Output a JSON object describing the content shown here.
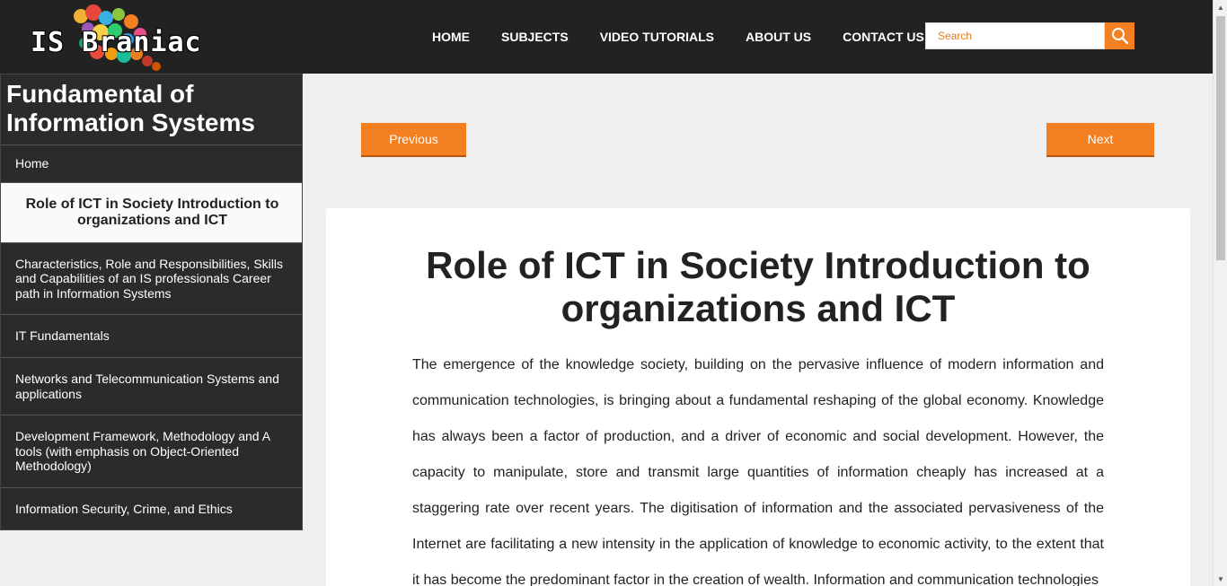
{
  "header": {
    "logo_text": "IS Braniac",
    "nav": [
      {
        "label": "HOME"
      },
      {
        "label": "SUBJECTS"
      },
      {
        "label": "VIDEO TUTORIALS"
      },
      {
        "label": "ABOUT US"
      },
      {
        "label": "CONTACT US"
      }
    ],
    "search": {
      "placeholder": "Search",
      "icon": "search-icon"
    }
  },
  "sidebar": {
    "title": "Fundamental of Information Systems",
    "items": [
      {
        "label": "Home",
        "active": false
      },
      {
        "label": "Role of ICT in Society Introduction to organizations and ICT",
        "active": true
      },
      {
        "label": "Characteristics, Role and Responsibilities, Skills and Capabilities of an IS professionals Career path in Information Systems",
        "active": false
      },
      {
        "label": "IT Fundamentals",
        "active": false
      },
      {
        "label": "Networks and Telecommunication Systems and applications",
        "active": false
      },
      {
        "label": "Development Framework, Methodology and A tools (with emphasis on Object-Oriented Methodology)",
        "active": false
      },
      {
        "label": "Information Security, Crime, and Ethics",
        "active": false
      }
    ]
  },
  "pager": {
    "previous": "Previous",
    "next": "Next"
  },
  "article": {
    "title": "Role of ICT in Society Introduction to organizations and ICT",
    "body": "The emergence of the knowledge society, building on the pervasive influence of modern information and communication technologies, is bringing about a fundamental reshaping of the global economy. Knowledge has always been a factor of production, and a driver of economic and social development. However, the capacity to manipulate, store and transmit large quantities of information cheaply has increased at a staggering rate over recent years. The digitisation of information and the associated pervasiveness of the Internet are facilitating a new intensity in the application of knowledge to economic activity, to the extent that it has become the predominant factor in the creation of wealth. Information and communication technologies"
  },
  "colors": {
    "accent": "#f47f20",
    "header_bg": "#222222",
    "sidebar_bg": "#2b2b2b",
    "page_bg": "#efefef"
  }
}
